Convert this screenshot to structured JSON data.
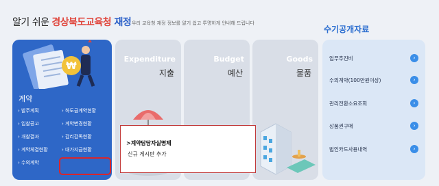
{
  "header": {
    "title_prefix": "알기 쉬운 ",
    "title_brand": "경상북도교육청",
    "title_suffix": " 재정",
    "description": "우리 교육청 재정 정보를 알기 쉽고 투명하게 안내해 드립니다",
    "public_title": "수기공개자료"
  },
  "contract": {
    "title": "계약",
    "menu": [
      "발주계획",
      "하도급계약현황",
      "입찰공고",
      "계약변경현황",
      "개찰결과",
      "감리감독현황",
      "계약체결현황",
      "대가지급현황",
      "수의계약",
      ""
    ]
  },
  "categories": [
    {
      "en": "Expenditure",
      "ko": "지출"
    },
    {
      "en": "Budget",
      "ko": "예산"
    },
    {
      "en": "Goods",
      "ko": "물품"
    }
  ],
  "popup": {
    "title": ">계약담당자실명제",
    "body": "신규 게시판 추가"
  },
  "public_items": [
    "업무추진비",
    "수의계약(100만원이상)",
    "관리전환소요조회",
    "상품권구매",
    "법인카드사용내역"
  ],
  "colors": {
    "brand_red": "#e0463c",
    "accent_blue": "#2e67c7",
    "highlight": "#d9252b"
  }
}
